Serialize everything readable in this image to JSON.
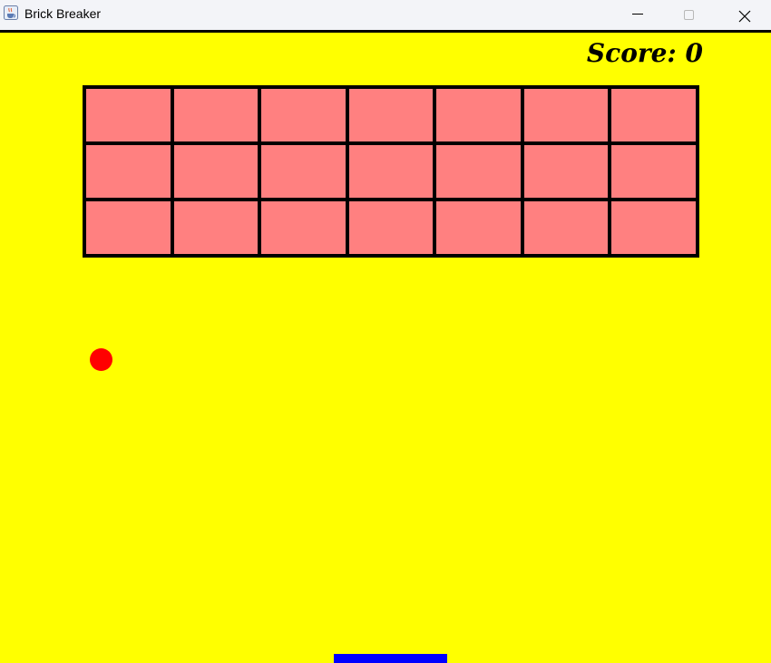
{
  "window": {
    "title": "Brick Breaker",
    "icon": "java-cup-icon",
    "controls": [
      "minimize-icon",
      "maximize-icon",
      "close-icon"
    ]
  },
  "game": {
    "score_label": "Score: 0",
    "score": 0,
    "background_color": "#ffff00",
    "brick_color": "#ff8080",
    "brick_border_color": "#000000",
    "ball_color": "#ff0000",
    "paddle_color": "#0000ff",
    "bricks": {
      "rows": 3,
      "columns": 7,
      "remaining": 21
    }
  }
}
